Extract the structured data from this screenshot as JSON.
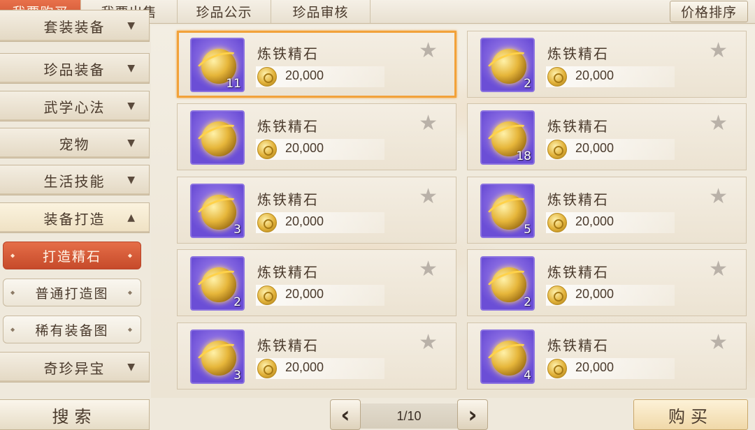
{
  "tabs": [
    {
      "label": "我要购买",
      "active": true
    },
    {
      "label": "我要出售",
      "active": false
    },
    {
      "label": "珍品公示",
      "active": false
    },
    {
      "label": "珍品审核",
      "active": false
    }
  ],
  "sort_label": "价格排序",
  "sidebar": {
    "items": [
      {
        "label": "套装装备",
        "arrow": "▼"
      },
      {
        "label": "珍品装备",
        "arrow": "▼"
      },
      {
        "label": "武学心法",
        "arrow": "▼"
      },
      {
        "label": "宠物",
        "arrow": "▼"
      },
      {
        "label": "生活技能",
        "arrow": "▼"
      },
      {
        "label": "装备打造",
        "arrow": "▲"
      },
      {
        "label": "奇珍异宝",
        "arrow": "▼"
      }
    ],
    "sub_items": [
      {
        "label": "打造精石",
        "active": true
      },
      {
        "label": "普通打造图",
        "active": false
      },
      {
        "label": "稀有装备图",
        "active": false
      }
    ]
  },
  "items": [
    {
      "name": "炼铁精石",
      "price": "20,000",
      "qty": "11",
      "selected": true
    },
    {
      "name": "炼铁精石",
      "price": "20,000",
      "qty": "2"
    },
    {
      "name": "炼铁精石",
      "price": "20,000",
      "qty": ""
    },
    {
      "name": "炼铁精石",
      "price": "20,000",
      "qty": "18"
    },
    {
      "name": "炼铁精石",
      "price": "20,000",
      "qty": "3"
    },
    {
      "name": "炼铁精石",
      "price": "20,000",
      "qty": "5"
    },
    {
      "name": "炼铁精石",
      "price": "20,000",
      "qty": "2"
    },
    {
      "name": "炼铁精石",
      "price": "20,000",
      "qty": "2"
    },
    {
      "name": "炼铁精石",
      "price": "20,000",
      "qty": "3"
    },
    {
      "name": "炼铁精石",
      "price": "20,000",
      "qty": "4"
    }
  ],
  "bottom": {
    "search_label": "搜索",
    "page_label": "1/10",
    "prev_icon": "‹",
    "next_icon": "›",
    "buy_label": "购买"
  },
  "colors": {
    "accent": "#d85c37",
    "selected_border": "#f2a23a",
    "item_bg": "#7b5ce0"
  }
}
